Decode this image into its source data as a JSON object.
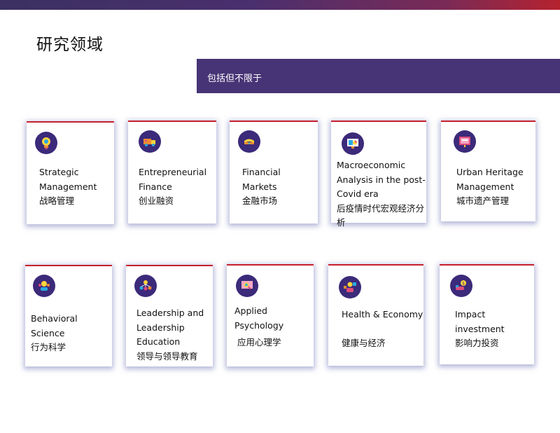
{
  "page": {
    "title": "研究领域",
    "banner_text": "包括但不限于"
  },
  "colors": {
    "banner": "#473476",
    "accent_red": "#c7202f",
    "icon_bg": "#3c2a7a"
  },
  "cards": [
    {
      "en_lines": [
        "Strategic",
        "Management"
      ],
      "cn": "战略管理",
      "icon": "lightbulb-icon"
    },
    {
      "en_lines": [
        "Entrepreneurial",
        "Finance"
      ],
      "cn": "创业融资",
      "icon": "delivery-truck-icon"
    },
    {
      "en_lines": [
        "Financial",
        "Markets"
      ],
      "cn": "金融市场",
      "icon": "money-stack-icon"
    },
    {
      "en_lines": [
        "Macroeconomic",
        "Analysis in the post-",
        "Covid era"
      ],
      "cn": "后疫情时代宏观经济分析",
      "icon": "monitor-chart-icon"
    },
    {
      "en_lines": [
        "Urban Heritage",
        "Management"
      ],
      "cn": "城市遗产管理",
      "icon": "presentation-board-icon"
    },
    {
      "en_lines": [
        "Behavioral Science"
      ],
      "cn": "行为科学",
      "icon": "people-group-icon"
    },
    {
      "en_lines": [
        "Leadership and",
        "Leadership",
        "Education"
      ],
      "cn": "领导与领导教育",
      "icon": "team-network-icon"
    },
    {
      "en_lines": [
        "Applied Psychology"
      ],
      "cn": "应用心理学",
      "icon": "analysis-screen-icon"
    },
    {
      "en_lines": [
        "Health & Economy"
      ],
      "cn": "健康与经济",
      "icon": "health-person-icon"
    },
    {
      "en_lines": [
        "Impact",
        "investment"
      ],
      "cn": "影响力投资",
      "icon": "coin-hand-icon"
    }
  ]
}
